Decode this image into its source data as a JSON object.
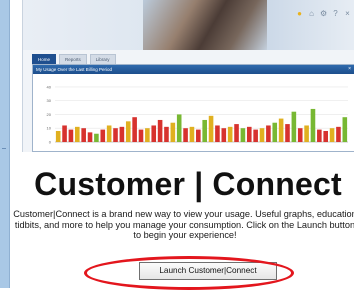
{
  "app": {
    "tabs": [
      {
        "label": "Home",
        "active": true
      },
      {
        "label": "Reports",
        "active": false
      },
      {
        "label": "Library",
        "active": false
      }
    ],
    "header_icons": [
      "star-icon",
      "home-icon",
      "gear-icon",
      "help-icon",
      "close-icon"
    ],
    "header_glyphs": [
      "●",
      "⌂",
      "⚙",
      "?",
      "×"
    ]
  },
  "chart_panel": {
    "title": "My Usage Over the Last Billing Period",
    "close_glyph": "×"
  },
  "chart_data": {
    "type": "bar",
    "title": "My Usage Over the Last Billing Period",
    "xlabel": "",
    "ylabel": "",
    "y_ticks": [
      "40",
      "30",
      "20",
      "10",
      "0"
    ],
    "ylim": [
      0,
      45
    ],
    "values": [
      8,
      12,
      9,
      11,
      10,
      7,
      6,
      9,
      12,
      10,
      11,
      15,
      18,
      9,
      10,
      12,
      16,
      11,
      14,
      20,
      10,
      11,
      9,
      16,
      19,
      12,
      10,
      11,
      13,
      10,
      11,
      9,
      10,
      12,
      14,
      17,
      13,
      22,
      10,
      12,
      24,
      9,
      8,
      10,
      11,
      18
    ],
    "colors": [
      "#e0b020",
      "#d7322e",
      "#d7322e",
      "#e0b020",
      "#d7322e",
      "#d7322e",
      "#78b833",
      "#d7322e",
      "#e0b020",
      "#d7322e",
      "#d7322e",
      "#e0b020",
      "#d7322e",
      "#d7322e",
      "#e0b020",
      "#d7322e",
      "#d7322e",
      "#d7322e",
      "#e0b020",
      "#78b833",
      "#d7322e",
      "#e0b020",
      "#d7322e",
      "#78b833",
      "#e0b020",
      "#d7322e",
      "#d7322e",
      "#e0b020",
      "#d7322e",
      "#78b833",
      "#d7322e",
      "#d7322e",
      "#e0b020",
      "#d7322e",
      "#78b833",
      "#e0b020",
      "#d7322e",
      "#78b833",
      "#d7322e",
      "#e0b020",
      "#78b833",
      "#d7322e",
      "#d7322e",
      "#e0b020",
      "#d7322e",
      "#78b833"
    ],
    "grid": true
  },
  "hero": {
    "title": "Customer | Connect"
  },
  "description": {
    "text": "Customer|Connect is a brand new way to view your usage. Useful graphs, education tidbits, and more to help you manage your consumption. Click on the Launch button to begin your experience!"
  },
  "launch": {
    "label": "Launch Customer|Connect",
    "highlight_color": "#e3161d"
  }
}
